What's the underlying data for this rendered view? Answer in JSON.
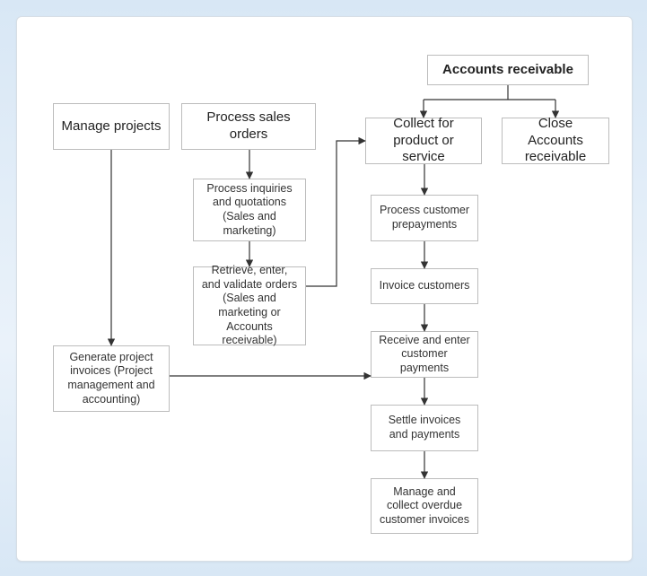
{
  "diagram": {
    "header": "Accounts receivable",
    "manage_projects": "Manage projects",
    "process_sales_orders": "Process sales orders",
    "collect_for_product": "Collect for product or service",
    "close_accounts": "Close Accounts receivable",
    "process_inquiries": "Process inquiries and quotations (Sales and marketing)",
    "retrieve_orders": "Retrieve, enter, and validate orders (Sales and marketing or Accounts receivable)",
    "generate_invoices": "Generate project invoices (Project management and accounting)",
    "process_prepayments": "Process customer prepayments",
    "invoice_customers": "Invoice customers",
    "receive_payments": "Receive and enter customer payments",
    "settle_invoices": "Settle invoices and payments",
    "manage_overdue": "Manage and collect overdue customer invoices"
  }
}
